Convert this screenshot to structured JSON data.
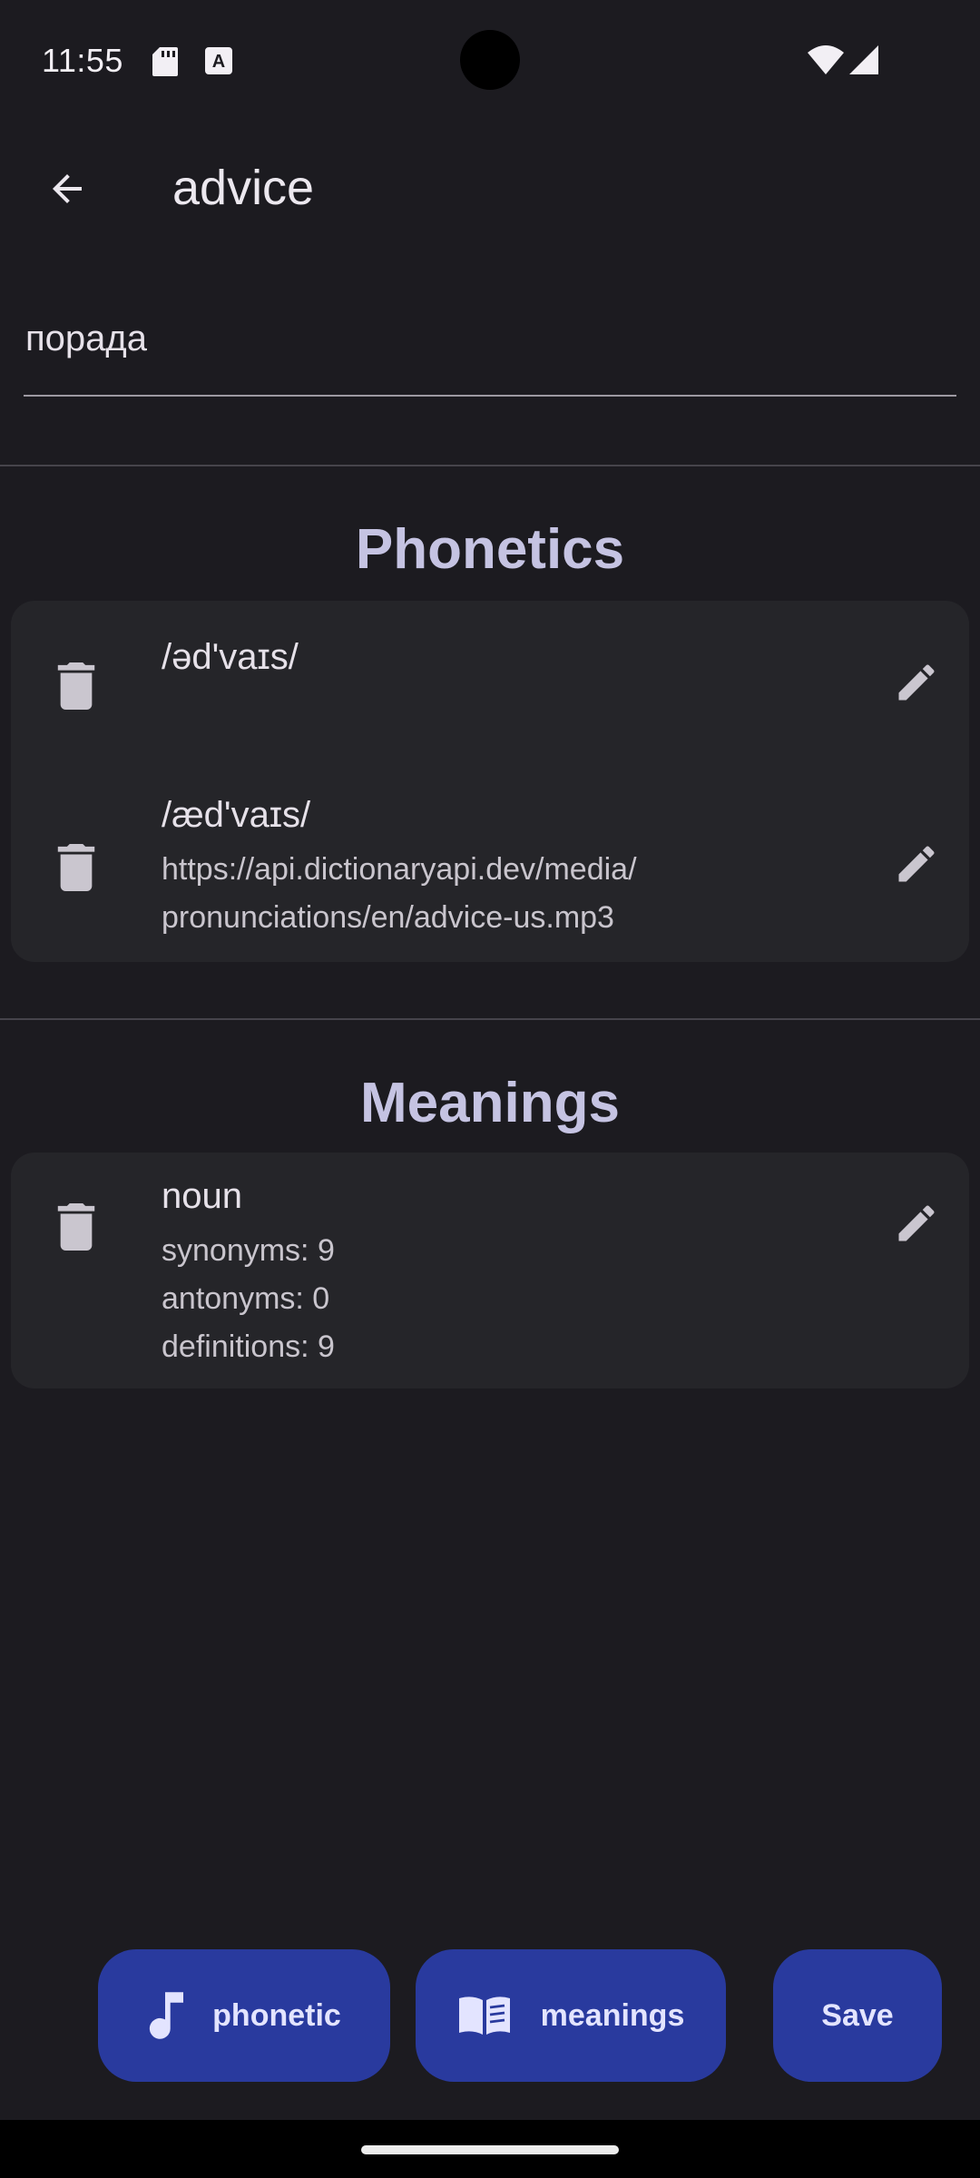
{
  "status_bar": {
    "time": "11:55",
    "icons": [
      "sd-card-icon",
      "text-a-icon",
      "wifi-icon",
      "signal-icon"
    ]
  },
  "app_bar": {
    "back_icon": "arrow-back-icon",
    "title": "advice"
  },
  "translation_field": {
    "value": "порада"
  },
  "phonetics": {
    "heading": "Phonetics",
    "items": [
      {
        "text": "/əd'vaɪs/",
        "audio": ""
      },
      {
        "text": "/æd'vaɪs/",
        "audio_line1": "https://api.dictionaryapi.dev/media/",
        "audio_line2": "pronunciations/en/advice-us.mp3"
      }
    ]
  },
  "meanings": {
    "heading": "Meanings",
    "items": [
      {
        "part_of_speech": "noun",
        "synonyms": "synonyms: 9",
        "antonyms": "antonyms: 0",
        "definitions": "definitions: 9"
      }
    ]
  },
  "actions": {
    "phonetic_label": "phonetic",
    "meanings_label": "meanings",
    "save_label": "Save"
  },
  "colors": {
    "background": "#1c1b20",
    "card": "#252529",
    "accent_button": "#293a9e",
    "heading": "#c5c3e2"
  }
}
